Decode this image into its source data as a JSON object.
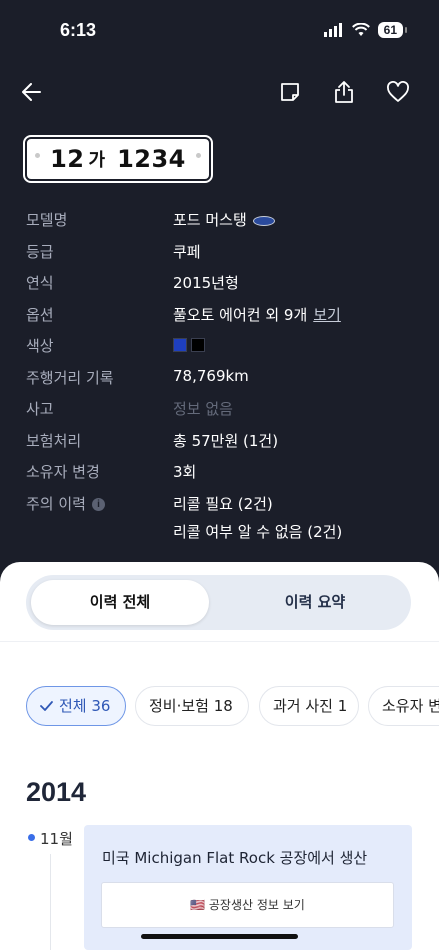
{
  "status_bar": {
    "time": "6:13",
    "battery": "61"
  },
  "plate": {
    "number_left": "12",
    "hangul": "가",
    "number_right": "1234"
  },
  "info_rows": [
    {
      "label": "모델명",
      "value": "포드 머스탱"
    },
    {
      "label": "등급",
      "value": "쿠페"
    },
    {
      "label": "연식",
      "value": "2015년형"
    },
    {
      "label": "옵션",
      "value": "풀오토 에어컨 외 9개",
      "link": "보기"
    },
    {
      "label": "색상",
      "value": ""
    },
    {
      "label": "주행거리 기록",
      "value": "78,769km"
    },
    {
      "label": "사고",
      "value": "정보 없음"
    },
    {
      "label": "보험처리",
      "value": "총 57만원 (1건)"
    },
    {
      "label": "소유자 변경",
      "value": "3회"
    },
    {
      "label": "주의 이력",
      "value": "리콜 필요 (2건)",
      "value2": "리콜 여부 알 수 없음 (2건)"
    }
  ],
  "colors": {
    "swatch_1": "#1e3fbf",
    "swatch_2": "#000000"
  },
  "tabs": {
    "active": "이력 전체",
    "inactive": "이력 요약"
  },
  "chips": [
    {
      "label": "전체 36",
      "active": true
    },
    {
      "label": "정비·보험 18",
      "active": false
    },
    {
      "label": "과거 사진 1",
      "active": false
    },
    {
      "label": "소유자 변",
      "active": false
    }
  ],
  "timeline": {
    "year": "2014",
    "month": "11월",
    "event_title": "미국 Michigan Flat Rock 공장에서 생산",
    "event_button": "🇺🇸 공장생산 정보 보기"
  }
}
